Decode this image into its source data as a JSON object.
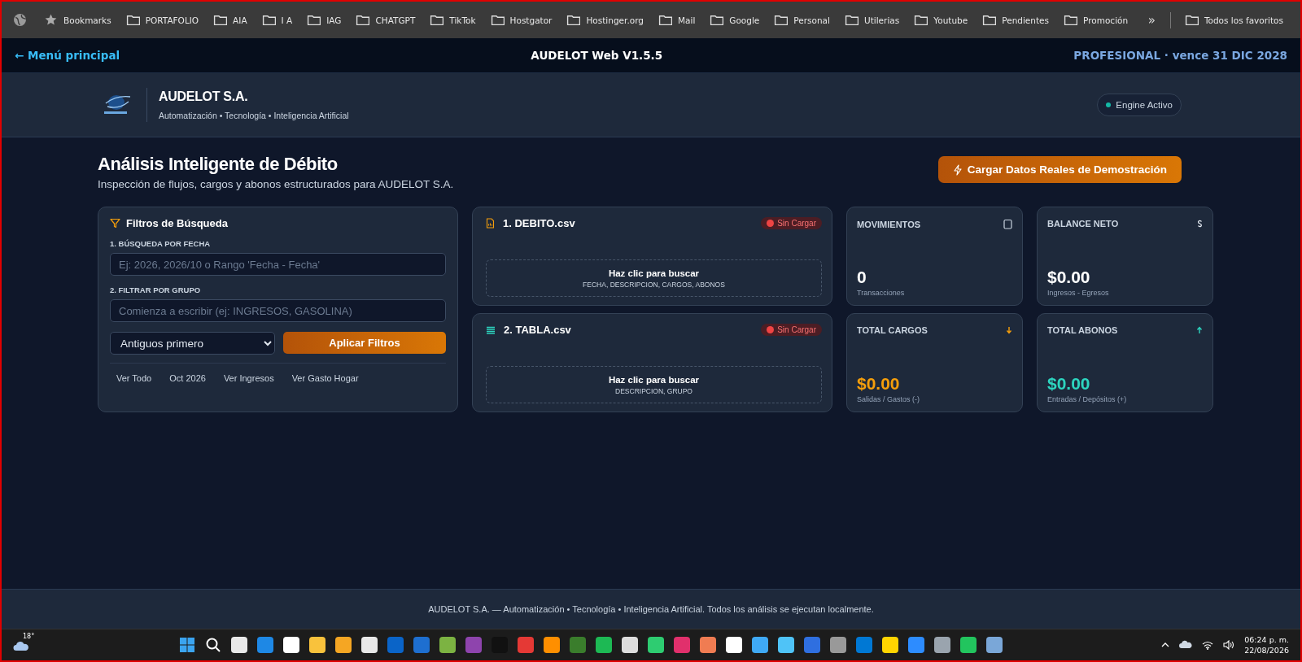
{
  "bookmarks_bar": {
    "items": [
      {
        "label": "Bookmarks",
        "kind": "star"
      },
      {
        "label": "PORTAFOLIO",
        "kind": "folder"
      },
      {
        "label": "AIA",
        "kind": "folder"
      },
      {
        "label": "I A",
        "kind": "folder"
      },
      {
        "label": "IAG",
        "kind": "folder"
      },
      {
        "label": "CHATGPT",
        "kind": "folder"
      },
      {
        "label": "TikTok",
        "kind": "folder"
      },
      {
        "label": "Hostgator",
        "kind": "folder"
      },
      {
        "label": "Hostinger.org",
        "kind": "folder"
      },
      {
        "label": "Mail",
        "kind": "folder"
      },
      {
        "label": "Google",
        "kind": "folder"
      },
      {
        "label": "Personal",
        "kind": "folder"
      },
      {
        "label": "Utilerias",
        "kind": "folder"
      },
      {
        "label": "Youtube",
        "kind": "folder"
      },
      {
        "label": "Pendientes",
        "kind": "folder"
      },
      {
        "label": "Promoción",
        "kind": "folder"
      }
    ],
    "overflow": "»",
    "all_bookmarks": "Todos los favoritos"
  },
  "nav": {
    "back_link": "← Menú principal",
    "title": "AUDELOT Web V1.5.5",
    "license": "PROFESIONAL · vence 31 DIC 2028"
  },
  "header": {
    "company": "AUDELOT S.A.",
    "tagline": "Automatización • Tecnología • Inteligencia Artificial",
    "engine": {
      "label": "Engine Activo",
      "active": true
    }
  },
  "page": {
    "title": "Análisis Inteligente de Débito",
    "subtitle": "Inspección de flujos, cargos y abonos estructurados para AUDELOT S.A.",
    "demo_button": "Cargar Datos Reales de Demostración"
  },
  "filters": {
    "title": "Filtros de Búsqueda",
    "fields": [
      {
        "label": "1. BÚSQUEDA POR FECHA",
        "placeholder": "Ej: 2026, 2026/10 o Rango 'Fecha - Fecha'"
      },
      {
        "label": "2. FILTRAR POR GRUPO",
        "placeholder": "Comienza a escribir (ej: INGRESOS, GASOLINA)"
      }
    ],
    "sort": "Antiguos primero",
    "apply_button": "Aplicar Filtros",
    "quick_filters": [
      "Ver Todo",
      "Oct 2026",
      "Ver Ingresos",
      "Ver Gasto Hogar"
    ]
  },
  "files": [
    {
      "kind": "document",
      "name": "1. DEBITO.csv",
      "status": "Sin Cargar",
      "loaded": false,
      "drop_title": "Haz clic para buscar",
      "drop_hint": "FECHA, DESCRIPCION, CARGOS, ABONOS"
    },
    {
      "kind": "table",
      "name": "2. TABLA.csv",
      "status": "Sin Cargar",
      "loaded": false,
      "drop_title": "Haz clic para buscar",
      "drop_hint": "DESCRIPCION, GRUPO"
    }
  ],
  "stats": [
    {
      "kind": "count",
      "label": "MOVIMIENTOS",
      "value": "0",
      "caption": "Transacciones"
    },
    {
      "kind": "balance",
      "label": "BALANCE NETO",
      "value": "$0.00",
      "caption": "Ingresos - Egresos"
    },
    {
      "kind": "debit",
      "label": "TOTAL CARGOS",
      "value": "$0.00",
      "caption": "Salidas / Gastos (-)"
    },
    {
      "kind": "credit",
      "label": "TOTAL ABONOS",
      "value": "$0.00",
      "caption": "Entradas / Depósitos (+)"
    }
  ],
  "footer": "AUDELOT S.A. — Automatización • Tecnología • Inteligencia Artificial. Todos los análisis se ejecutan localmente.",
  "taskbar": {
    "weather": "18°",
    "time": "06:24 p. m.",
    "date": "22/08/2026"
  }
}
